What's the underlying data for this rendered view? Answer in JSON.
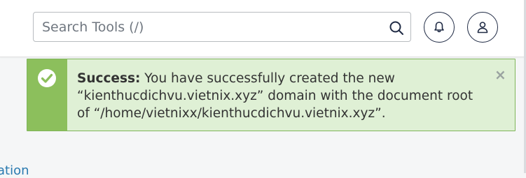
{
  "search": {
    "placeholder": "Search Tools (/)",
    "value": ""
  },
  "icons": {
    "search": "search-icon",
    "notifications": "bell-icon",
    "account": "user-icon",
    "success": "check-circle-icon",
    "close": "close-icon"
  },
  "alert": {
    "title": "Success:",
    "message": " You have successfully created the new “kienthucdichvu.vietnix.xyz” domain with the document root of “/home/vietnixx/kienthucdichvu.vietnix.xyz”.",
    "close_label": "×"
  },
  "partial_link": {
    "label": "ation"
  },
  "colors": {
    "alert_bg": "#dff0d5",
    "alert_stripe": "#8cbf5c",
    "icon_stroke": "#1f2a44",
    "link": "#2a7ab0"
  }
}
